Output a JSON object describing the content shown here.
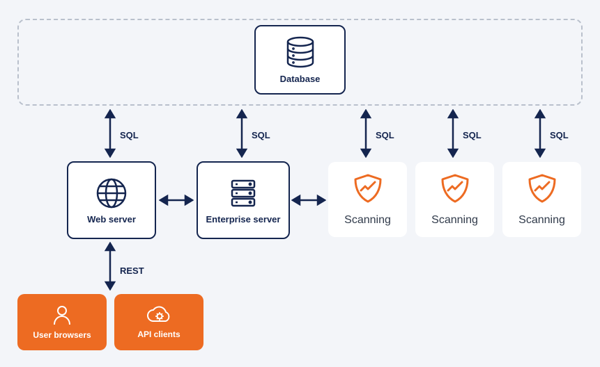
{
  "database": {
    "label": "Database"
  },
  "web_server": {
    "label": "Web server"
  },
  "enterprise_server": {
    "label": "Enterprise server"
  },
  "scanning": {
    "label": "Scanning"
  },
  "user_browsers": {
    "label": "User browsers"
  },
  "api_clients": {
    "label": "API clients"
  },
  "arrows": {
    "sql": "SQL",
    "rest": "REST"
  }
}
